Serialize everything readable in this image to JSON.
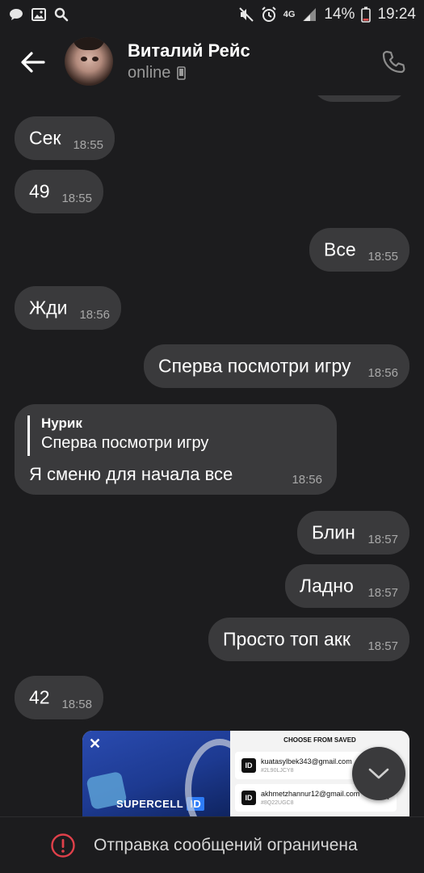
{
  "status_bar": {
    "battery": "14%",
    "time": "19:24",
    "network": "4G",
    "icons": [
      "message-icon",
      "image-icon",
      "search-icon",
      "mute-icon",
      "alarm-icon",
      "signal-icon",
      "battery-icon"
    ]
  },
  "header": {
    "contact_name": "Виталий Рейс",
    "status": "online"
  },
  "messages": [
    {
      "side": "in",
      "text": "Сек",
      "time": "18:55"
    },
    {
      "side": "in",
      "text": "49",
      "time": "18:55"
    },
    {
      "side": "out",
      "text": "Все",
      "time": "18:55"
    },
    {
      "side": "in",
      "text": "Жди",
      "time": "18:56"
    },
    {
      "side": "out",
      "text": "Сперва посмотри игру",
      "time": "18:56"
    },
    {
      "side": "in",
      "reply_author": "Нурик",
      "reply_text": "Сперва посмотри игру",
      "text": "Я сменю для начала все",
      "time": "18:56"
    },
    {
      "side": "out",
      "text": "Блин",
      "time": "18:57"
    },
    {
      "side": "out",
      "text": "Ладно",
      "time": "18:57"
    },
    {
      "side": "out",
      "text": "Просто топ акк",
      "time": "18:57"
    },
    {
      "side": "in",
      "text": "42",
      "time": "18:58"
    }
  ],
  "media": {
    "close": "✕",
    "brand": "SUPERCELL",
    "brand_id": "ID",
    "saved_title": "CHOOSE FROM SAVED",
    "accounts": [
      {
        "email": "kuatasylbek343@gmail.com",
        "tag": "#2L90LJCY8"
      },
      {
        "email": "akhmetzhannur12@gmail.com",
        "tag": "#8Q22UGC8"
      }
    ],
    "id_label": "ID"
  },
  "bottom": {
    "restriction_text": "Отправка сообщений ограничена"
  },
  "colors": {
    "background": "#1c1c1e",
    "bubble": "#3a3a3c",
    "time": "#a8a8a8",
    "alert": "#e0404a"
  }
}
